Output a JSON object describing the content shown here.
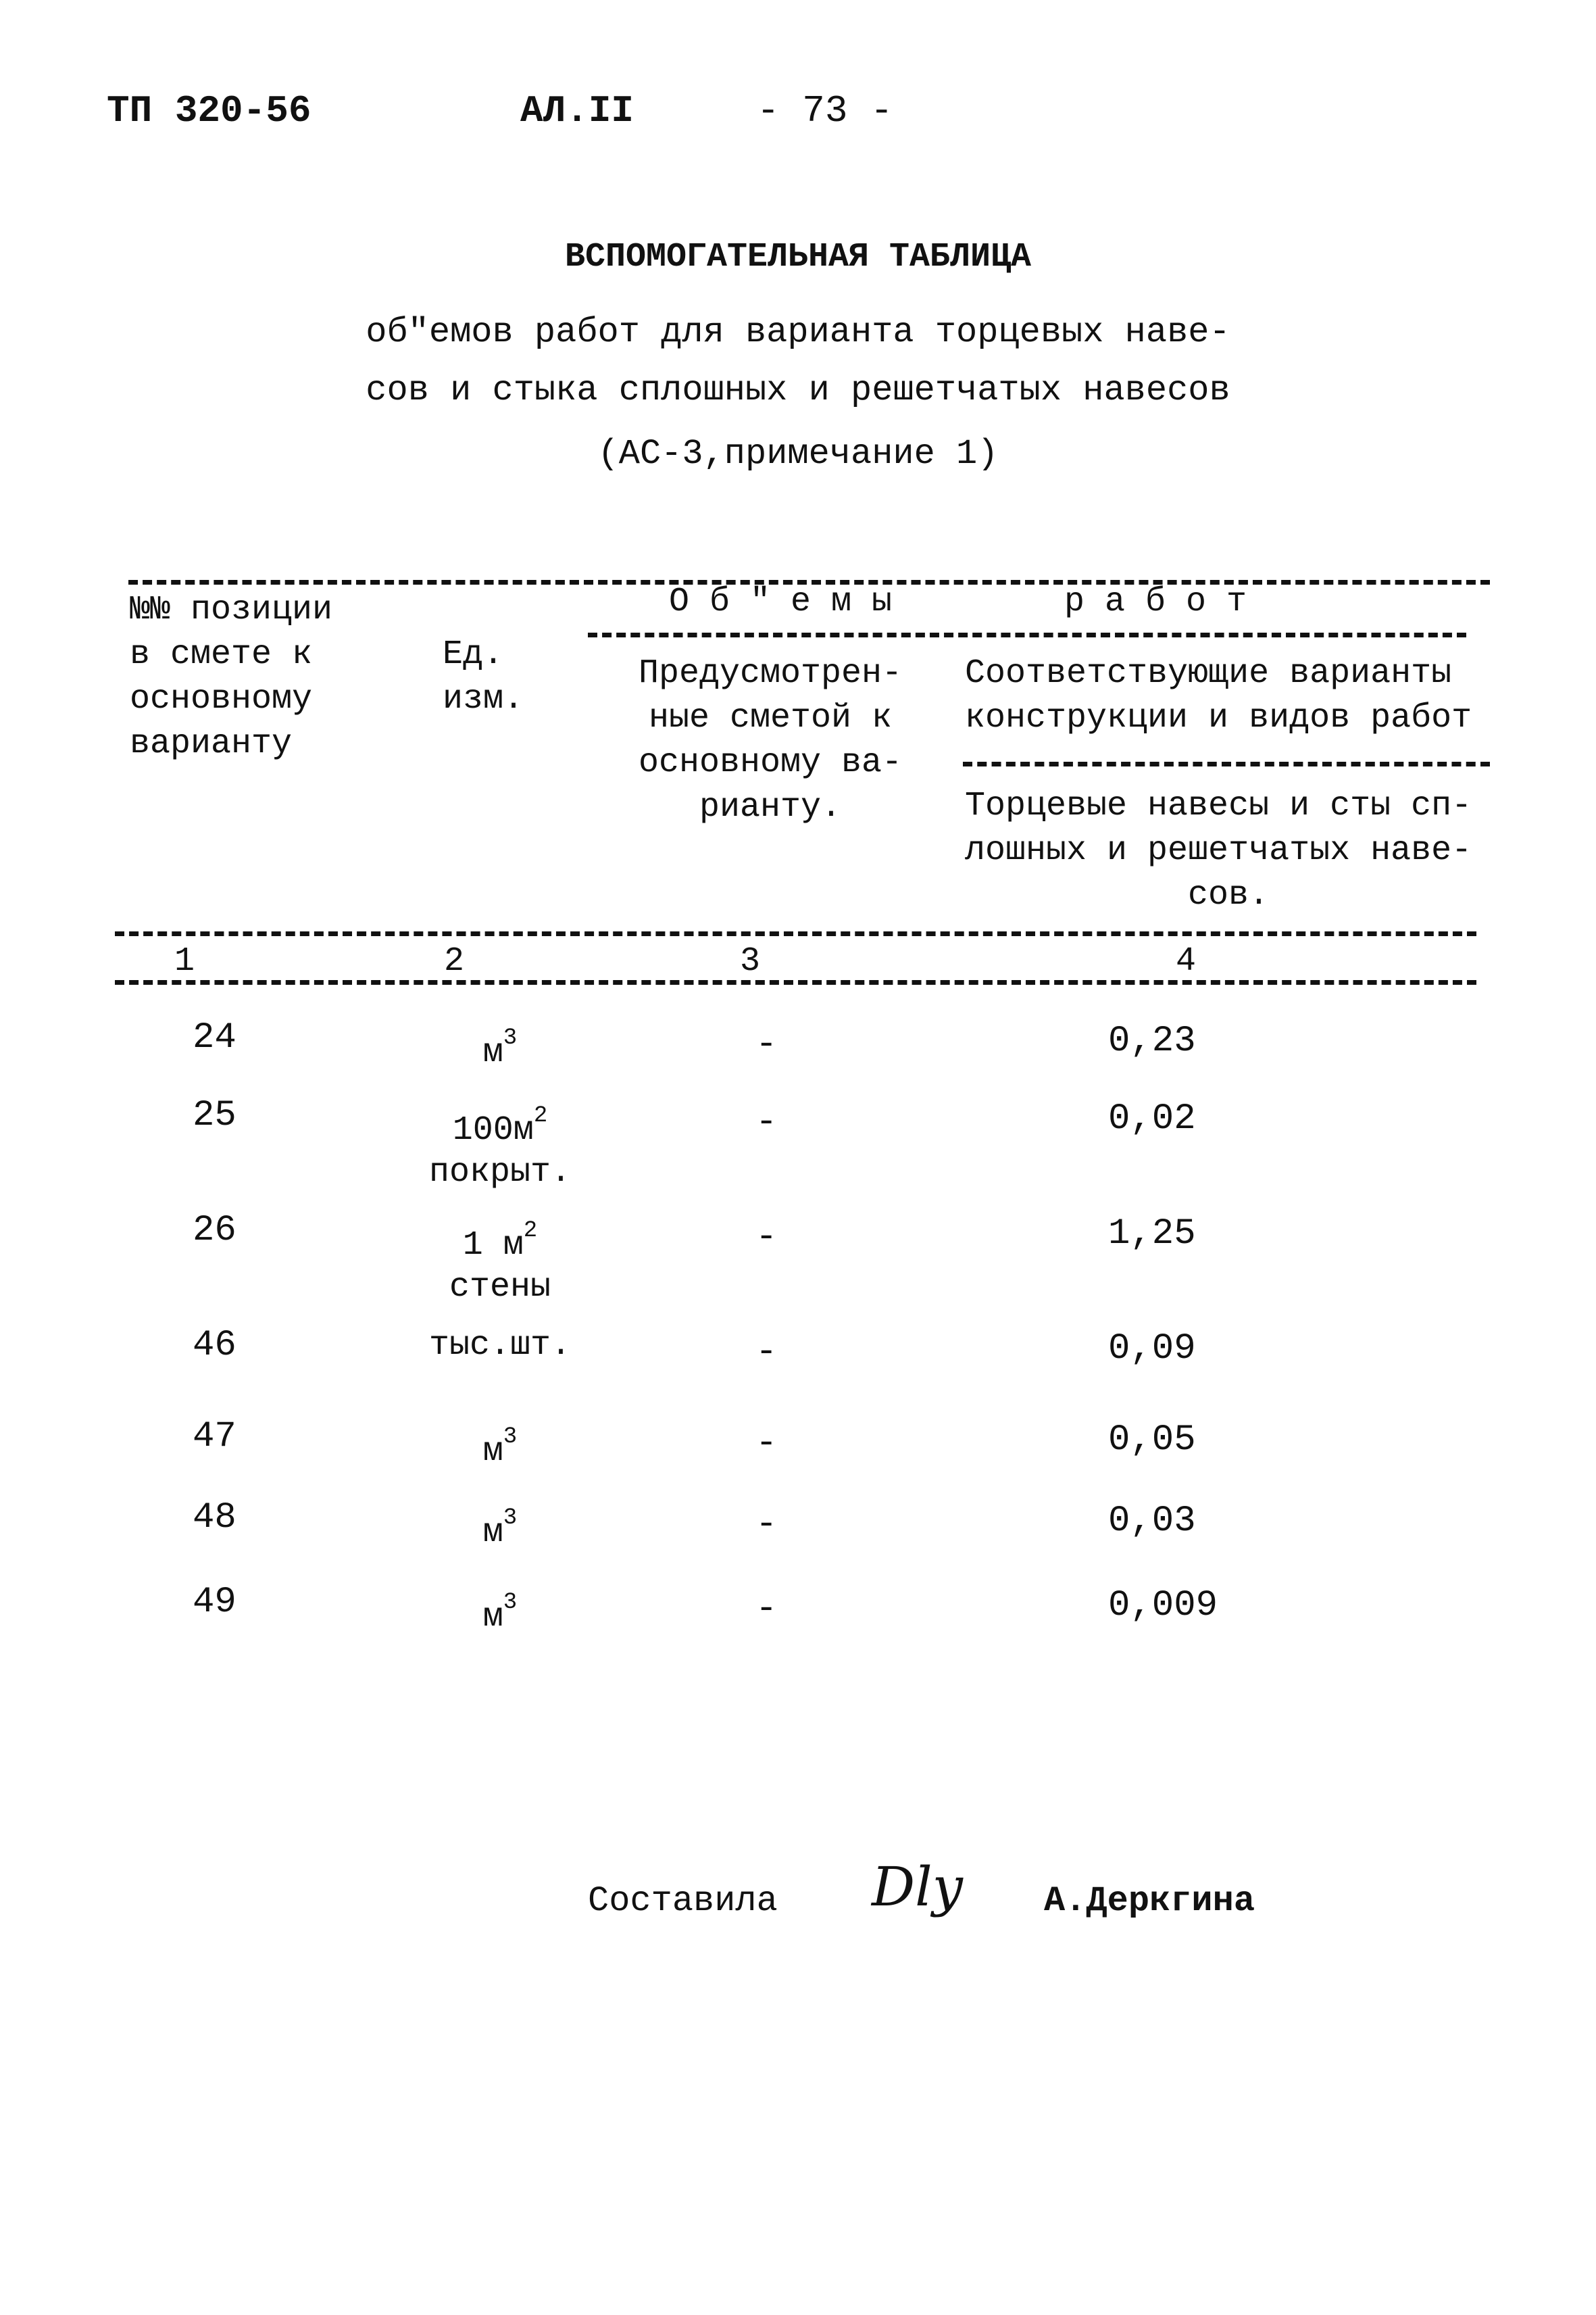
{
  "document_header": {
    "code": "ТП 320-56",
    "album": "АЛ.II",
    "page": "- 73 -"
  },
  "title": "ВСПОМОГАТЕЛЬНАЯ ТАБЛИЦА",
  "subtitle_lines": [
    "об\"емов работ для варианта торцевых наве-",
    "сов и стыка сплошных и решетчатых навесов",
    "(АС-3,примечание 1)"
  ],
  "table": {
    "group_header": {
      "left": "О б \" е м ы",
      "right": "р а б о т"
    },
    "columns": {
      "col1": [
        "№№ позиции",
        "в смете к",
        "основному",
        "варианту"
      ],
      "col2": [
        "Ед.",
        "изм."
      ],
      "col3": [
        "Предусмотрен-",
        "ные сметой к",
        "основному ва-",
        "рианту."
      ],
      "col4_group": [
        "Соответствующие варианты",
        "конструкции и видов работ"
      ],
      "col4": [
        "Торцевые навесы и сты сп-",
        "лошных и решетчатых наве-",
        "сов."
      ]
    },
    "column_numbers": [
      "1",
      "2",
      "3",
      "4"
    ],
    "rows": [
      {
        "position": "24",
        "unit": "м",
        "unit_sup": "3",
        "unit_line2": "",
        "planned": "-",
        "value": "0,23"
      },
      {
        "position": "25",
        "unit": "100м",
        "unit_sup": "2",
        "unit_line2": "покрыт.",
        "planned": "-",
        "value": "0,02"
      },
      {
        "position": "26",
        "unit": "1 м",
        "unit_sup": "2",
        "unit_line2": "стены",
        "planned": "-",
        "value": "1,25"
      },
      {
        "position": "46",
        "unit": "тыс.шт.",
        "unit_sup": "",
        "unit_line2": "",
        "planned": "-",
        "value": "0,09"
      },
      {
        "position": "47",
        "unit": "м",
        "unit_sup": "3",
        "unit_line2": "",
        "planned": "-",
        "value": "0,05"
      },
      {
        "position": "48",
        "unit": "м",
        "unit_sup": "3",
        "unit_line2": "",
        "planned": "-",
        "value": "0,03"
      },
      {
        "position": "49",
        "unit": "м",
        "unit_sup": "3",
        "unit_line2": "",
        "planned": "-",
        "value": "0,009"
      }
    ]
  },
  "footer": {
    "compiled_by_label": "Составила",
    "signature": "Dly",
    "name": "А.Деркгина"
  }
}
